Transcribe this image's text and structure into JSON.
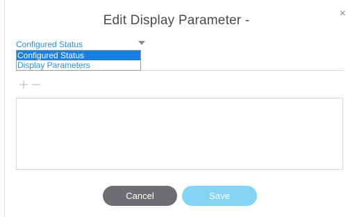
{
  "dialog": {
    "title": "Edit Display Parameter -",
    "close_glyph": "×"
  },
  "select": {
    "current_value": "Configured Status",
    "options": [
      {
        "label": "Configured Status",
        "selected": true
      },
      {
        "label": "Display Parameters",
        "selected": false
      }
    ]
  },
  "toolbar": {
    "add_icon": "plus-icon",
    "remove_icon": "minus-icon"
  },
  "buttons": {
    "cancel_label": "Cancel",
    "save_label": "Save"
  },
  "colors": {
    "accent": "#2b8fd6",
    "selected_option_bg": "#1a7fe3",
    "cancel_bg": "#6c6e71",
    "save_bg_disabled": "#83d3f5"
  }
}
